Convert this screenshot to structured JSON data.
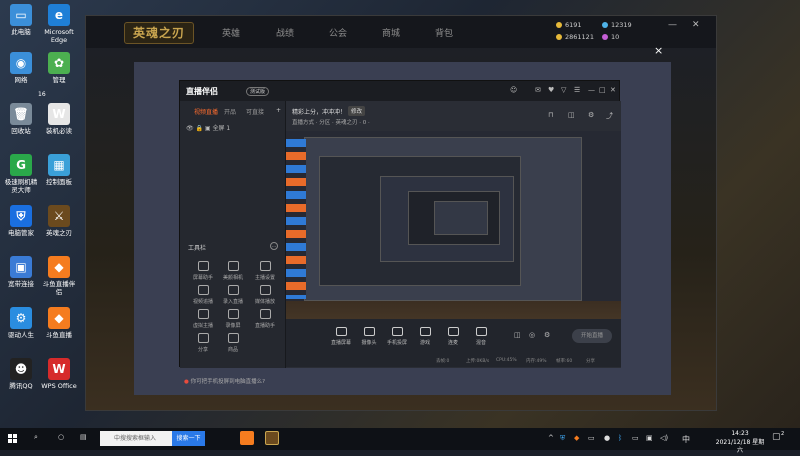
{
  "desktop": {
    "icons": [
      {
        "label": "此电脑",
        "color": "#3b8fd9",
        "glyph": "▭"
      },
      {
        "label": "Microsoft Edge",
        "color": "#1f7fd6",
        "glyph": "e"
      },
      {
        "label": "网络",
        "color": "#3b8fd9",
        "glyph": "◉"
      },
      {
        "label": "管理",
        "color": "#4caf50",
        "glyph": "✿"
      },
      {
        "label": "回收站",
        "color": "#7a8a99",
        "glyph": "🗑"
      },
      {
        "label": "装机必读",
        "color": "#e6e6e6",
        "glyph": "W"
      },
      {
        "label": "极速刷机精灵大师",
        "color": "#2aa84a",
        "glyph": "G"
      },
      {
        "label": "控制面板",
        "color": "#3aa0d8",
        "glyph": "▦"
      },
      {
        "label": "电脑管家",
        "color": "#1a6fe0",
        "glyph": "⛨"
      },
      {
        "label": "英魂之刃",
        "color": "#6b4a1e",
        "glyph": "⚔"
      },
      {
        "label": "宽带连接",
        "color": "#3a7bd5",
        "glyph": "▣"
      },
      {
        "label": "斗鱼直播伴侣",
        "color": "#f57c1f",
        "glyph": "◆"
      },
      {
        "label": "驱动人生",
        "color": "#2a8de0",
        "glyph": "⚙"
      },
      {
        "label": "斗鱼直播",
        "color": "#f57c1f",
        "glyph": "◆"
      },
      {
        "label": "腾讯QQ",
        "color": "#222",
        "glyph": "☻"
      },
      {
        "label": "WPS Office",
        "color": "#d62b2b",
        "glyph": "W"
      }
    ],
    "misc_label": "16"
  },
  "game": {
    "logo": "英魂之刃",
    "nav": [
      "英雄",
      "战绩",
      "公会",
      "商城",
      "背包"
    ],
    "stats": [
      "6191",
      "12319",
      "2861121",
      "10"
    ],
    "overlay_close": "×"
  },
  "app": {
    "logo": "直播伴侣",
    "version": "测试版",
    "left_tabs": [
      "视频直播",
      "开品",
      "可直接"
    ],
    "scene": "全屏 1",
    "tools_header": "工具栏",
    "tools": [
      "屏幕助手",
      "美颜相机",
      "主播设置",
      "视频追播",
      "录入直播",
      "媒体播放",
      "虚拟主播",
      "录像屏",
      "直播助手",
      "分享",
      "商品"
    ],
    "footer_hint": "你可把手机投屏到电脑直播么?",
    "live_title": "精彩上分，冲冲冲！",
    "live_tag": "修改",
    "live_sub": "直播方式 · 分区 · 英魂之刃 · 0 ·",
    "bottom_buttons": [
      "直播屏幕",
      "摄像头",
      "手机投屏",
      "游戏",
      "连麦",
      "混音"
    ],
    "start_label": "开始直播",
    "status": [
      "丢帧:0",
      "上传:0KB/s",
      "CPU:45%",
      "内存:49%",
      "帧率:60",
      "分享"
    ]
  },
  "taskbar": {
    "search_placeholder": "中搜搜索框输入",
    "search_button": "搜索一下",
    "time": "14:23",
    "date": "2021/12/18 星期六",
    "lang": "中",
    "notifications": "2"
  }
}
